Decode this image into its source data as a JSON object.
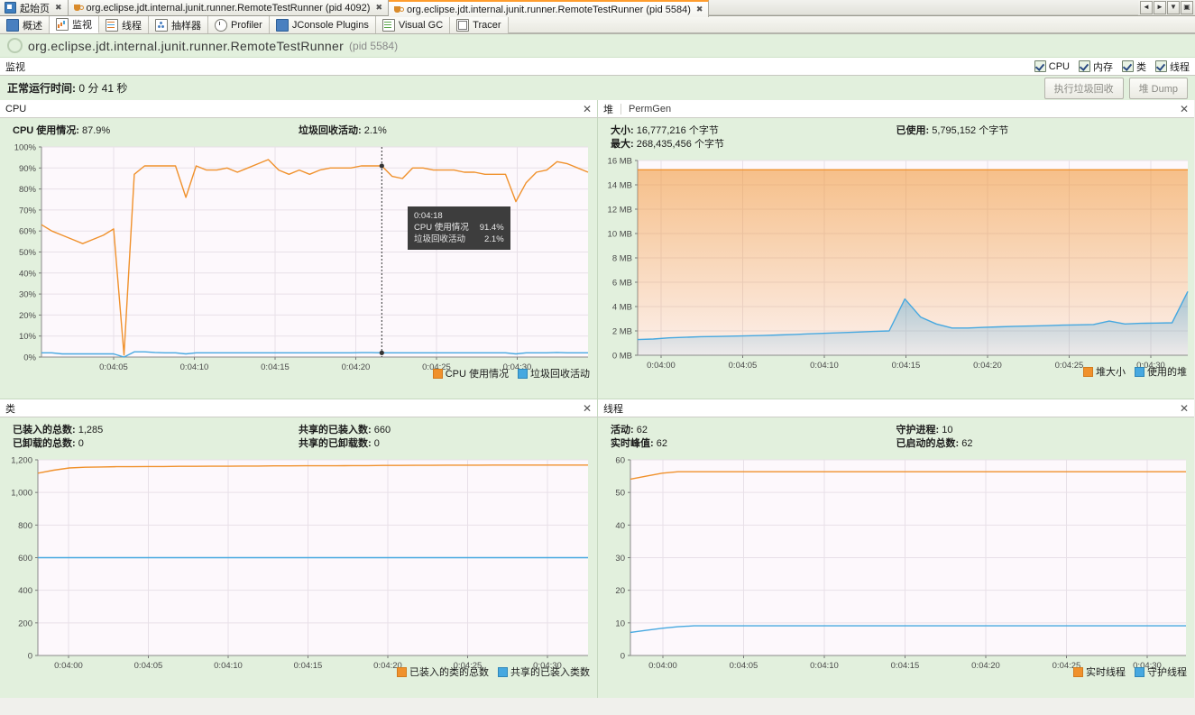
{
  "window": {
    "tabs": [
      {
        "label": "起始页",
        "icon": "page-icon",
        "active": false,
        "closable": true
      },
      {
        "label": "org.eclipse.jdt.internal.junit.runner.RemoteTestRunner (pid 4092)",
        "icon": "java-cup-icon",
        "active": false,
        "closable": true
      },
      {
        "label": "org.eclipse.jdt.internal.junit.runner.RemoteTestRunner (pid 5584)",
        "icon": "java-cup-icon",
        "active": true,
        "closable": true
      }
    ],
    "nav_buttons": [
      "◄",
      "►",
      "▼",
      "▣"
    ]
  },
  "toolbar_tabs": [
    {
      "label": "概述",
      "icon": "overview-icon",
      "active": false
    },
    {
      "label": "监视",
      "icon": "monitor-icon",
      "active": true
    },
    {
      "label": "线程",
      "icon": "threads-icon",
      "active": false
    },
    {
      "label": "抽样器",
      "icon": "sampler-icon",
      "active": false
    },
    {
      "label": "Profiler",
      "icon": "profiler-icon",
      "active": false
    },
    {
      "label": "JConsole Plugins",
      "icon": "jconsole-icon",
      "active": false
    },
    {
      "label": "Visual GC",
      "icon": "visualgc-icon",
      "active": false
    },
    {
      "label": "Tracer",
      "icon": "tracer-icon",
      "active": false
    }
  ],
  "app_header": {
    "name": "org.eclipse.jdt.internal.junit.runner.RemoteTestRunner",
    "pid": "(pid 5584)"
  },
  "view": {
    "title": "监视",
    "checkboxes": [
      {
        "label": "CPU",
        "checked": true
      },
      {
        "label": "内存",
        "checked": true
      },
      {
        "label": "类",
        "checked": true
      },
      {
        "label": "线程",
        "checked": true
      }
    ]
  },
  "uptime": {
    "label": "正常运行时间:",
    "value": "0 分 41 秒"
  },
  "actions": {
    "gc_label": "执行垃圾回收",
    "heapdump_label": "堆 Dump"
  },
  "panels": {
    "cpu": {
      "title": "CPU",
      "close": "✕",
      "stats": [
        {
          "label": "CPU 使用情况:",
          "value": "87.9%"
        },
        {
          "label": "垃圾回收活动:",
          "value": "2.1%"
        }
      ],
      "tooltip": {
        "time": "0:04:18",
        "rows": [
          {
            "label": "CPU 使用情况",
            "value": "91.4%"
          },
          {
            "label": "垃圾回收活动",
            "value": "2.1%"
          }
        ]
      }
    },
    "heap": {
      "title": "堆",
      "subtitle": "PermGen",
      "close": "✕",
      "stats": [
        {
          "label": "大小:",
          "value": "16,777,216 个字节"
        },
        {
          "label": "已使用:",
          "value": "5,795,152 个字节"
        },
        {
          "label": "最大:",
          "value": "268,435,456 个字节"
        }
      ]
    },
    "classes": {
      "title": "类",
      "close": "✕",
      "stats": [
        {
          "label": "已装入的总数:",
          "value": "1,285"
        },
        {
          "label": "共享的已装入数:",
          "value": "660"
        },
        {
          "label": "已卸载的总数:",
          "value": "0"
        },
        {
          "label": "共享的已卸载数:",
          "value": "0"
        }
      ]
    },
    "threads": {
      "title": "线程",
      "close": "✕",
      "stats": [
        {
          "label": "活动:",
          "value": "62"
        },
        {
          "label": "守护进程:",
          "value": "10"
        },
        {
          "label": "实时峰值:",
          "value": "62"
        },
        {
          "label": "已启动的总数:",
          "value": "62"
        }
      ]
    }
  },
  "colors": {
    "orange": "#f0912c",
    "blue": "#46a8e0",
    "panel_bg": "#e2f0dd",
    "plot_bg": "#fdf8fc"
  },
  "chart_data": [
    {
      "id": "cpu",
      "type": "line",
      "title": "CPU",
      "xlabel": "",
      "ylabel": "",
      "ylim": [
        0,
        100
      ],
      "yticks": [
        "0%",
        "10%",
        "20%",
        "30%",
        "40%",
        "50%",
        "60%",
        "70%",
        "80%",
        "90%",
        "100%"
      ],
      "xticks": [
        "0:04:05",
        "0:04:10",
        "0:04:15",
        "0:04:20",
        "0:04:25",
        "0:04:30"
      ],
      "grid": true,
      "legend_position": "bottom-right",
      "series": [
        {
          "name": "CPU 使用情况",
          "color": "#f0912c",
          "values": [
            63,
            60,
            58,
            56,
            54,
            56,
            58,
            61,
            1,
            87,
            91,
            91,
            91,
            91,
            76,
            91,
            89,
            89,
            90,
            88,
            90,
            92,
            94,
            89,
            87,
            89,
            87,
            89,
            90,
            90,
            90,
            91,
            91,
            91,
            86,
            85,
            90,
            90,
            89,
            89,
            89,
            88,
            88,
            87,
            87,
            87,
            74,
            83,
            88,
            89,
            93,
            92,
            90,
            88
          ]
        },
        {
          "name": "垃圾回收活动",
          "color": "#46a8e0",
          "values": [
            2,
            2,
            1.5,
            1.5,
            1.5,
            1.5,
            1.5,
            1.5,
            0,
            2.5,
            2.5,
            2.2,
            2,
            2,
            1.5,
            2,
            2,
            2,
            2,
            2,
            2,
            2,
            2,
            2,
            2,
            2,
            2,
            2,
            2,
            2,
            2,
            2.1,
            2.1,
            2,
            2,
            2,
            2,
            2,
            2,
            2,
            2,
            2,
            2,
            2,
            2,
            2,
            1.5,
            2,
            2,
            2,
            2.2,
            2,
            2,
            2
          ]
        }
      ],
      "cursor": {
        "x_label": "0:04:18",
        "series_values": [
          91.4,
          2.1
        ]
      }
    },
    {
      "id": "heap",
      "type": "area",
      "title": "堆 PermGen",
      "ylim": [
        0,
        16.8
      ],
      "yticks": [
        "0 MB",
        "2 MB",
        "4 MB",
        "6 MB",
        "8 MB",
        "10 MB",
        "12 MB",
        "14 MB",
        "16 MB"
      ],
      "xticks": [
        "0:04:00",
        "0:04:05",
        "0:04:10",
        "0:04:15",
        "0:04:20",
        "0:04:25",
        "0:04:30"
      ],
      "grid": true,
      "legend_position": "bottom-right",
      "series": [
        {
          "name": "堆大小",
          "color": "#f0912c",
          "values": [
            16,
            16,
            16,
            16,
            16,
            16,
            16,
            16,
            16,
            16,
            16,
            16,
            16,
            16,
            16,
            16,
            16,
            16,
            16,
            16,
            16,
            16,
            16,
            16,
            16,
            16,
            16,
            16,
            16,
            16,
            16,
            16,
            16,
            16,
            16,
            16
          ]
        },
        {
          "name": "使用的堆",
          "color": "#46a8e0",
          "values": [
            1.35,
            1.4,
            1.5,
            1.55,
            1.6,
            1.62,
            1.65,
            1.68,
            1.7,
            1.75,
            1.8,
            1.85,
            1.9,
            1.95,
            2.0,
            2.05,
            2.1,
            4.85,
            3.3,
            2.7,
            2.35,
            2.35,
            2.4,
            2.45,
            2.5,
            2.52,
            2.55,
            2.6,
            2.62,
            2.65,
            2.95,
            2.7,
            2.75,
            2.78,
            2.8,
            5.5
          ]
        }
      ]
    },
    {
      "id": "classes",
      "type": "line",
      "title": "类",
      "ylim": [
        0,
        1320
      ],
      "yticks": [
        "0",
        "200",
        "400",
        "600",
        "800",
        "1,000",
        "1,200"
      ],
      "xticks": [
        "0:04:00",
        "0:04:05",
        "0:04:10",
        "0:04:15",
        "0:04:20",
        "0:04:25",
        "0:04:30"
      ],
      "grid": true,
      "legend_position": "bottom-right",
      "series": [
        {
          "name": "已装入的类的总数",
          "color": "#f0912c",
          "values": [
            1230,
            1250,
            1265,
            1270,
            1272,
            1274,
            1274,
            1275,
            1275,
            1276,
            1276,
            1277,
            1277,
            1278,
            1278,
            1279,
            1279,
            1280,
            1280,
            1280,
            1281,
            1281,
            1282,
            1282,
            1283,
            1283,
            1284,
            1284,
            1284,
            1285,
            1285,
            1285,
            1285,
            1285,
            1285,
            1285
          ]
        },
        {
          "name": "共享的已装入类数",
          "color": "#46a8e0",
          "values": [
            660,
            660,
            660,
            660,
            660,
            660,
            660,
            660,
            660,
            660,
            660,
            660,
            660,
            660,
            660,
            660,
            660,
            660,
            660,
            660,
            660,
            660,
            660,
            660,
            660,
            660,
            660,
            660,
            660,
            660,
            660,
            660,
            660,
            660,
            660,
            660
          ]
        }
      ]
    },
    {
      "id": "threads",
      "type": "line",
      "title": "线程",
      "ylim": [
        0,
        66
      ],
      "yticks": [
        "0",
        "10",
        "20",
        "30",
        "40",
        "50",
        "60"
      ],
      "xticks": [
        "0:04:00",
        "0:04:05",
        "0:04:10",
        "0:04:15",
        "0:04:20",
        "0:04:25",
        "0:04:30"
      ],
      "grid": true,
      "legend_position": "bottom-right",
      "series": [
        {
          "name": "实时线程",
          "color": "#f0912c",
          "values": [
            59.5,
            60.5,
            61.5,
            62,
            62,
            62,
            62,
            62,
            62,
            62,
            62,
            62,
            62,
            62,
            62,
            62,
            62,
            62,
            62,
            62,
            62,
            62,
            62,
            62,
            62,
            62,
            62,
            62,
            62,
            62,
            62,
            62,
            62,
            62,
            62,
            62
          ]
        },
        {
          "name": "守护线程",
          "color": "#46a8e0",
          "values": [
            7.8,
            8.5,
            9.2,
            9.7,
            10,
            10,
            10,
            10,
            10,
            10,
            10,
            10,
            10,
            10,
            10,
            10,
            10,
            10,
            10,
            10,
            10,
            10,
            10,
            10,
            10,
            10,
            10,
            10,
            10,
            10,
            10,
            10,
            10,
            10,
            10,
            10
          ]
        }
      ]
    }
  ]
}
